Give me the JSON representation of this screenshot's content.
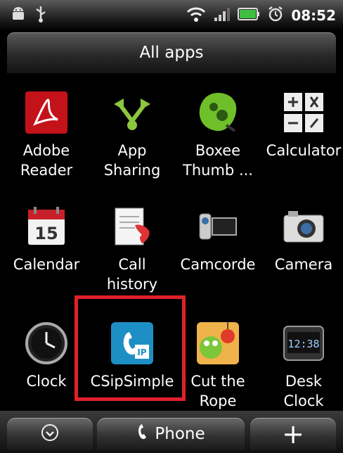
{
  "status_bar": {
    "time": "08:52",
    "icons": [
      "android-icon",
      "usb-icon",
      "wifi-icon",
      "signal-icon",
      "battery-icon",
      "alarm-icon"
    ]
  },
  "title": "All apps",
  "apps": [
    {
      "label": "Adobe\nReader",
      "icon": "adobe-reader-icon"
    },
    {
      "label": "App\nSharing",
      "icon": "app-sharing-icon"
    },
    {
      "label": "Boxee\nThumb ...",
      "icon": "boxee-icon"
    },
    {
      "label": "Calculator",
      "icon": "calculator-icon"
    },
    {
      "label": "Calendar",
      "icon": "calendar-icon"
    },
    {
      "label": "Call\nhistory",
      "icon": "call-history-icon"
    },
    {
      "label": "Camcorde",
      "icon": "camcorder-icon"
    },
    {
      "label": "Camera",
      "icon": "camera-icon"
    },
    {
      "label": "Clock",
      "icon": "clock-icon"
    },
    {
      "label": "CSipSimple",
      "icon": "csipsimple-icon"
    },
    {
      "label": "Cut the\nRope",
      "icon": "cut-the-rope-icon"
    },
    {
      "label": "Desk\nClock",
      "icon": "desk-clock-icon"
    }
  ],
  "calendar_day": "15",
  "csip_badge": "IP",
  "desk_clock_time": "12:38",
  "dock": {
    "phone_label": "Phone",
    "plus_symbol": "+"
  },
  "colors": {
    "highlight": "#e0202c",
    "csip_blue": "#1e8fc4",
    "adobe_red": "#c4121a"
  }
}
